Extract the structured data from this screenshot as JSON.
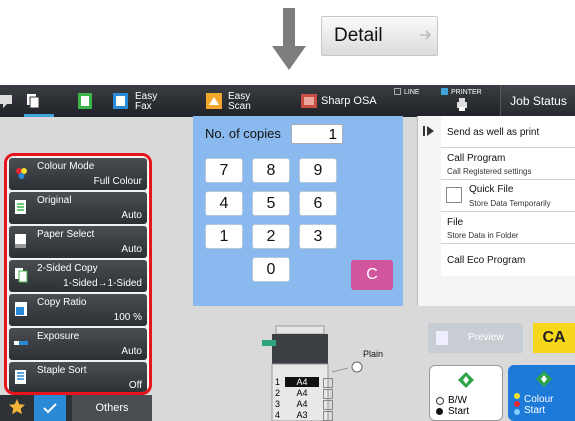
{
  "detail_button": {
    "label": "Detail"
  },
  "topbar": {
    "easy_fax": [
      "Easy",
      "Fax"
    ],
    "easy_scan": [
      "Easy",
      "Scan"
    ],
    "sharp_osa": "Sharp OSA",
    "line": "LINE",
    "printer": "PRINTER",
    "job_status": "Job Status"
  },
  "settings": [
    {
      "title": "Colour Mode",
      "value": "Full Colour",
      "icon": "colour-mode-icon"
    },
    {
      "title": "Original",
      "value": "Auto",
      "icon": "original-icon"
    },
    {
      "title": "Paper Select",
      "value": "Auto",
      "icon": "paper-select-icon"
    },
    {
      "title": "2-Sided Copy",
      "value": "1-Sided→1-Sided",
      "icon": "duplex-icon"
    },
    {
      "title": "Copy Ratio",
      "value": "100 %",
      "icon": "copy-ratio-icon"
    },
    {
      "title": "Exposure",
      "value": "Auto",
      "icon": "exposure-icon"
    },
    {
      "title": "Staple Sort",
      "value": "Off",
      "icon": "staple-sort-icon"
    }
  ],
  "copies": {
    "label": "No. of copies",
    "value": "1"
  },
  "keys": [
    "7",
    "8",
    "9",
    "4",
    "5",
    "6",
    "1",
    "2",
    "3",
    "0"
  ],
  "clear_label": "C",
  "right_menu": [
    {
      "title": "Send as well as print",
      "sub": ""
    },
    {
      "title": "Call Program",
      "sub": "Call Registered settings"
    },
    {
      "title": "Quick File",
      "sub": "Store Data Temporarily"
    },
    {
      "title": "File",
      "sub": "Store Data in Folder"
    },
    {
      "title": "Call Eco Program",
      "sub": ""
    }
  ],
  "preview_label": "Preview",
  "ca_label": "CA",
  "paper_label": "Plain",
  "trays": [
    {
      "n": "1",
      "size": "A4"
    },
    {
      "n": "2",
      "size": "A4"
    },
    {
      "n": "3",
      "size": "A4"
    },
    {
      "n": "4",
      "size": "A3"
    }
  ],
  "start_bw": {
    "line1": "B/W",
    "line2": "Start"
  },
  "start_colour": {
    "line1": "Colour",
    "line2": "Start"
  },
  "others_label": "Others"
}
